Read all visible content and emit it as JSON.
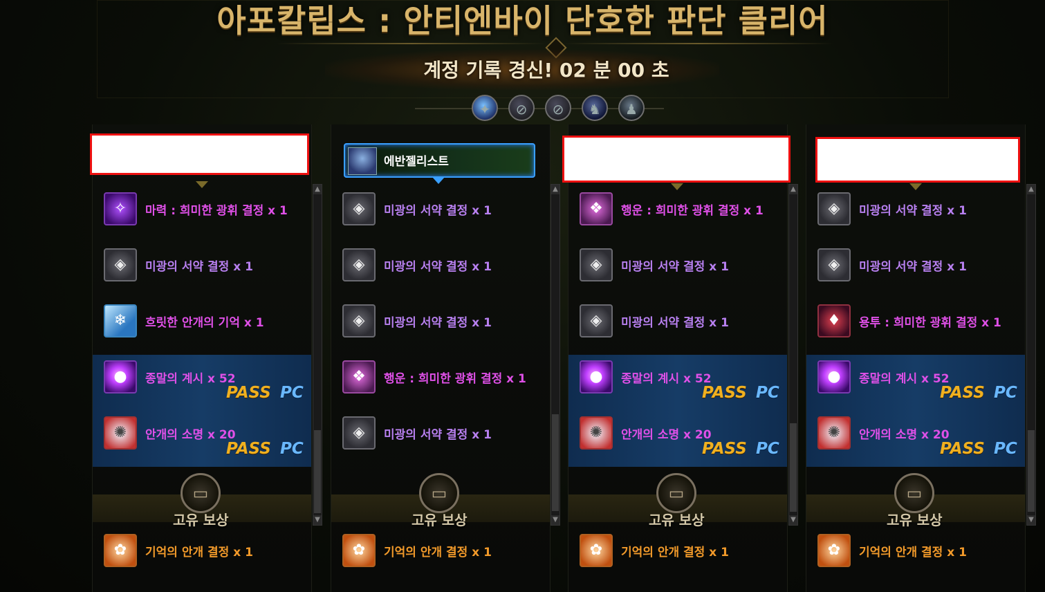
{
  "title": "아포칼립스 : 안티엔바이 단호한 판단 클리어",
  "record": "계정 기록 경신!  02 분 00 초",
  "party_icons": [
    "portrait-1-icon",
    "slashed-circle-icon",
    "slashed-circle-icon",
    "portrait-2-icon",
    "portrait-3-icon"
  ],
  "active_character": "에반젤리스트",
  "bonus_label": "고유 보상",
  "pass_text": "PASS",
  "pc_text": "PC",
  "columns": [
    {
      "items": [
        {
          "text": "마력 : 희미한 광휘 결정 x 1"
        },
        {
          "text": "미광의 서약 결정 x 1"
        },
        {
          "text": "흐릿한 안개의 기억 x 1"
        },
        {
          "text": "종말의 계시 x 52"
        },
        {
          "text": "안개의 소명 x 20"
        }
      ],
      "bonus": "기억의 안개 결정 x 1"
    },
    {
      "items": [
        {
          "text": "미광의 서약 결정 x 1"
        },
        {
          "text": "미광의 서약 결정 x 1"
        },
        {
          "text": "미광의 서약 결정 x 1"
        },
        {
          "text": "행운 : 희미한 광휘 결정 x 1"
        },
        {
          "text": "미광의 서약 결정 x 1"
        }
      ],
      "bonus": "기억의 안개 결정 x 1"
    },
    {
      "items": [
        {
          "text": "행운 : 희미한 광휘 결정 x 1"
        },
        {
          "text": "미광의 서약 결정 x 1"
        },
        {
          "text": "미광의 서약 결정 x 1"
        },
        {
          "text": "종말의 계시 x 52"
        },
        {
          "text": "안개의 소명 x 20"
        }
      ],
      "bonus": "기억의 안개 결정 x 1"
    },
    {
      "items": [
        {
          "text": "미광의 서약 결정 x 1"
        },
        {
          "text": "미광의 서약 결정 x 1"
        },
        {
          "text": "용투 : 희미한 광휘 결정 x 1"
        },
        {
          "text": "종말의 계시 x 52"
        },
        {
          "text": "안개의 소명 x 20"
        }
      ],
      "bonus": "기억의 안개 결정 x 1"
    }
  ]
}
